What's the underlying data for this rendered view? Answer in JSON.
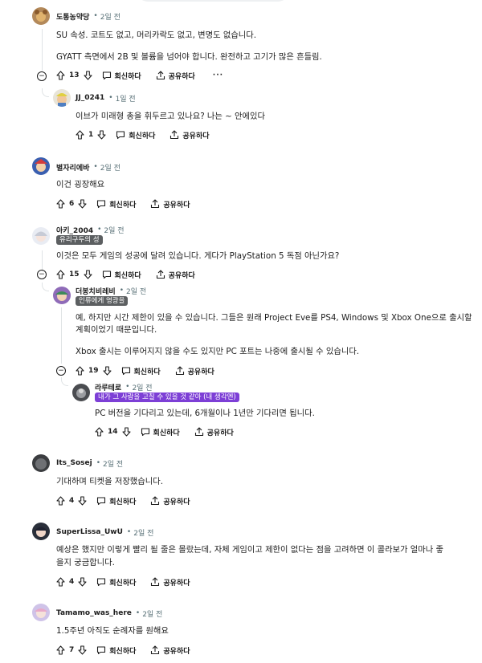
{
  "comments": [
    {
      "user": "도통농약당",
      "time": "2일 전",
      "lines": [
        "SU 속성. 코트도 없고, 머리카락도 없고, 변명도 없습니다.",
        "GYATT 측면에서 2B 및 볼륨을 넘어야 합니다. 완전하고 고기가 많은 흔들림."
      ],
      "votes": "13",
      "reply": "회신하다",
      "share": "공유하다",
      "more": "···"
    },
    {
      "user": "JJ_0241",
      "time": "1일 전",
      "lines": [
        "이브가 미래형 총을 휘두르고 있나요? 나는 ~ 안에있다"
      ],
      "votes": "1",
      "reply": "회신하다",
      "share": "공유하다"
    },
    {
      "user": "별자리에바",
      "time": "2일 전",
      "lines": [
        "이건 굉장해요"
      ],
      "votes": "6",
      "reply": "회신하다",
      "share": "공유하다"
    },
    {
      "user": "아키_2004",
      "time": "2일 전",
      "flair": "유리구두의 성",
      "lines": [
        "이것은 모두 게임의 성공에 달려 있습니다. 게다가 PlayStation 5 독점 아닌가요?"
      ],
      "votes": "15",
      "reply": "회신하다",
      "share": "공유하다"
    },
    {
      "user": "더봉치비레비",
      "time": "2일 전",
      "flair": "인류에게 영광을",
      "lines": [
        "예, 하지만 시간 제한이 있을 수 있습니다. 그들은 원래 Project Eve를 PS4, Windows 및 Xbox One으로 출시할",
        "계획이었기 때문입니다.",
        "Xbox 출시는 이루어지지 않을 수도 있지만 PC 포트는 나중에 출시될 수 있습니다."
      ],
      "votes": "19",
      "reply": "회신하다",
      "share": "공유하다"
    },
    {
      "user": "라루테로",
      "time": "2일 전",
      "flair": "내가 그 사람을 고칠 수 있을 것 같아 (내 생각엔)",
      "lines": [
        "PC 버전을 기다리고 있는데, 6개월이나 1년만 기다리면 됩니다."
      ],
      "votes": "14",
      "reply": "회신하다",
      "share": "공유하다"
    },
    {
      "user": "Its_Sosej",
      "time": "2일 전",
      "lines": [
        "기대하며 티켓을 저장했습니다."
      ],
      "votes": "4",
      "reply": "회신하다",
      "share": "공유하다"
    },
    {
      "user": "SuperLissa_UwU",
      "time": "2일 전",
      "lines": [
        "예상은 했지만 이렇게 빨리 될 줄은 몰랐는데, 자체 게임이고 제한이 없다는 점을 고려하면 이 콜라보가 얼마나 좋",
        "을지 궁금합니다."
      ],
      "votes": "4",
      "reply": "회신하다",
      "share": "공유하다"
    },
    {
      "user": "Tamamo_was_here",
      "time": "2일 전",
      "lines": [
        "1.5주년 아직도 순례자를 원해요"
      ],
      "votes": "7",
      "reply": "회신하다",
      "share": "공유하다"
    }
  ],
  "dot": "•",
  "collapse_symbol": "−",
  "colors": {
    "text": "#1c1c1c",
    "meta": "#576f76",
    "flair_dark": "#5c5f61",
    "flair_purple": "#7d3fd6",
    "thread": "#dfe3e5"
  },
  "icons": [
    "upvote-icon",
    "downvote-icon",
    "comment-icon",
    "share-icon",
    "more-icon",
    "collapse-icon"
  ]
}
